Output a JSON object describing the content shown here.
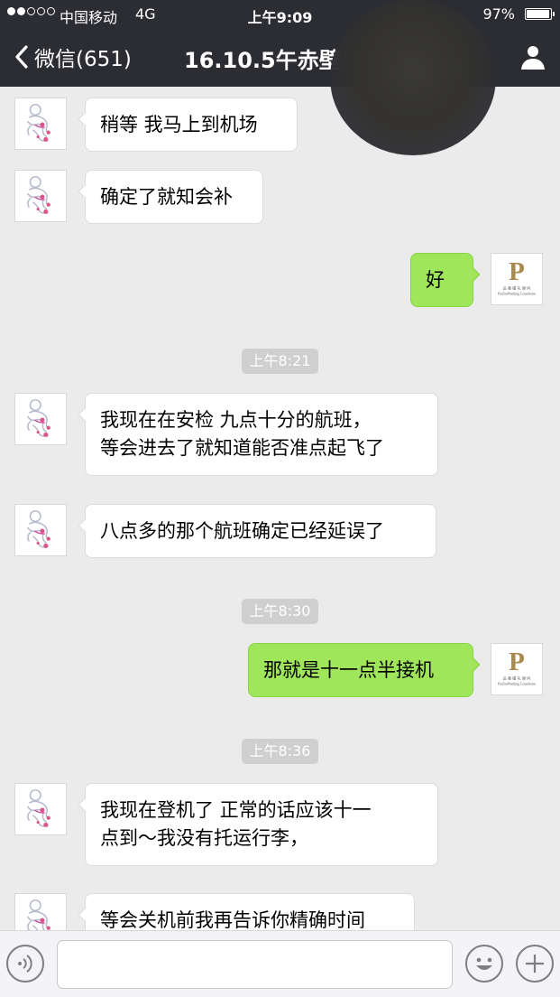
{
  "status_bar": {
    "signal_dots": [
      true,
      true,
      false,
      false,
      false
    ],
    "carrier": "中国移动",
    "network": "4G",
    "time": "上午9:09",
    "battery_percent": "97%",
    "battery_level": 0.97
  },
  "nav": {
    "back_label": "微信(651)",
    "title": "16.10.5午赤壁"
  },
  "messages": [
    {
      "type": "text",
      "side": "left",
      "text": "稍等 我马上到机场"
    },
    {
      "type": "text",
      "side": "left",
      "text": "确定了就知会补"
    },
    {
      "type": "text",
      "side": "right",
      "text": "好"
    },
    {
      "type": "time",
      "text": "上午8:21"
    },
    {
      "type": "text",
      "side": "left",
      "text": "我现在在安检 九点十分的航班，\n等会进去了就知道能否准点起飞了"
    },
    {
      "type": "text",
      "side": "left",
      "text": "八点多的那个航班确定已经延误了"
    },
    {
      "type": "time",
      "text": "上午8:30"
    },
    {
      "type": "text",
      "side": "right",
      "text": "那就是十一点半接机"
    },
    {
      "type": "time",
      "text": "上午8:36"
    },
    {
      "type": "text",
      "side": "left",
      "text": "我现在登机了 正常的话应该十一\n点到～我没有托运行李，"
    },
    {
      "type": "text",
      "side": "left",
      "text": "等会关机前我再告诉你精确时间"
    }
  ],
  "my_avatar": {
    "logo_letter": "P",
    "logo_text_cn": "品 尊 婚 礼 顾 问",
    "logo_text_en": "PinZunWedding Consultants",
    "brand_color": "#a8894f"
  },
  "contact_avatar": {
    "icon": "crouching-figure-icon"
  },
  "input_bar": {
    "voice_icon": "voice-icon",
    "emoji_icon": "emoji-icon",
    "plus_icon": "plus-icon",
    "text_value": ""
  },
  "colors": {
    "header_bg": "#2c2d32",
    "chat_bg": "#ebebeb",
    "outgoing_bubble": "#9fe65b",
    "incoming_bubble": "#ffffff"
  }
}
